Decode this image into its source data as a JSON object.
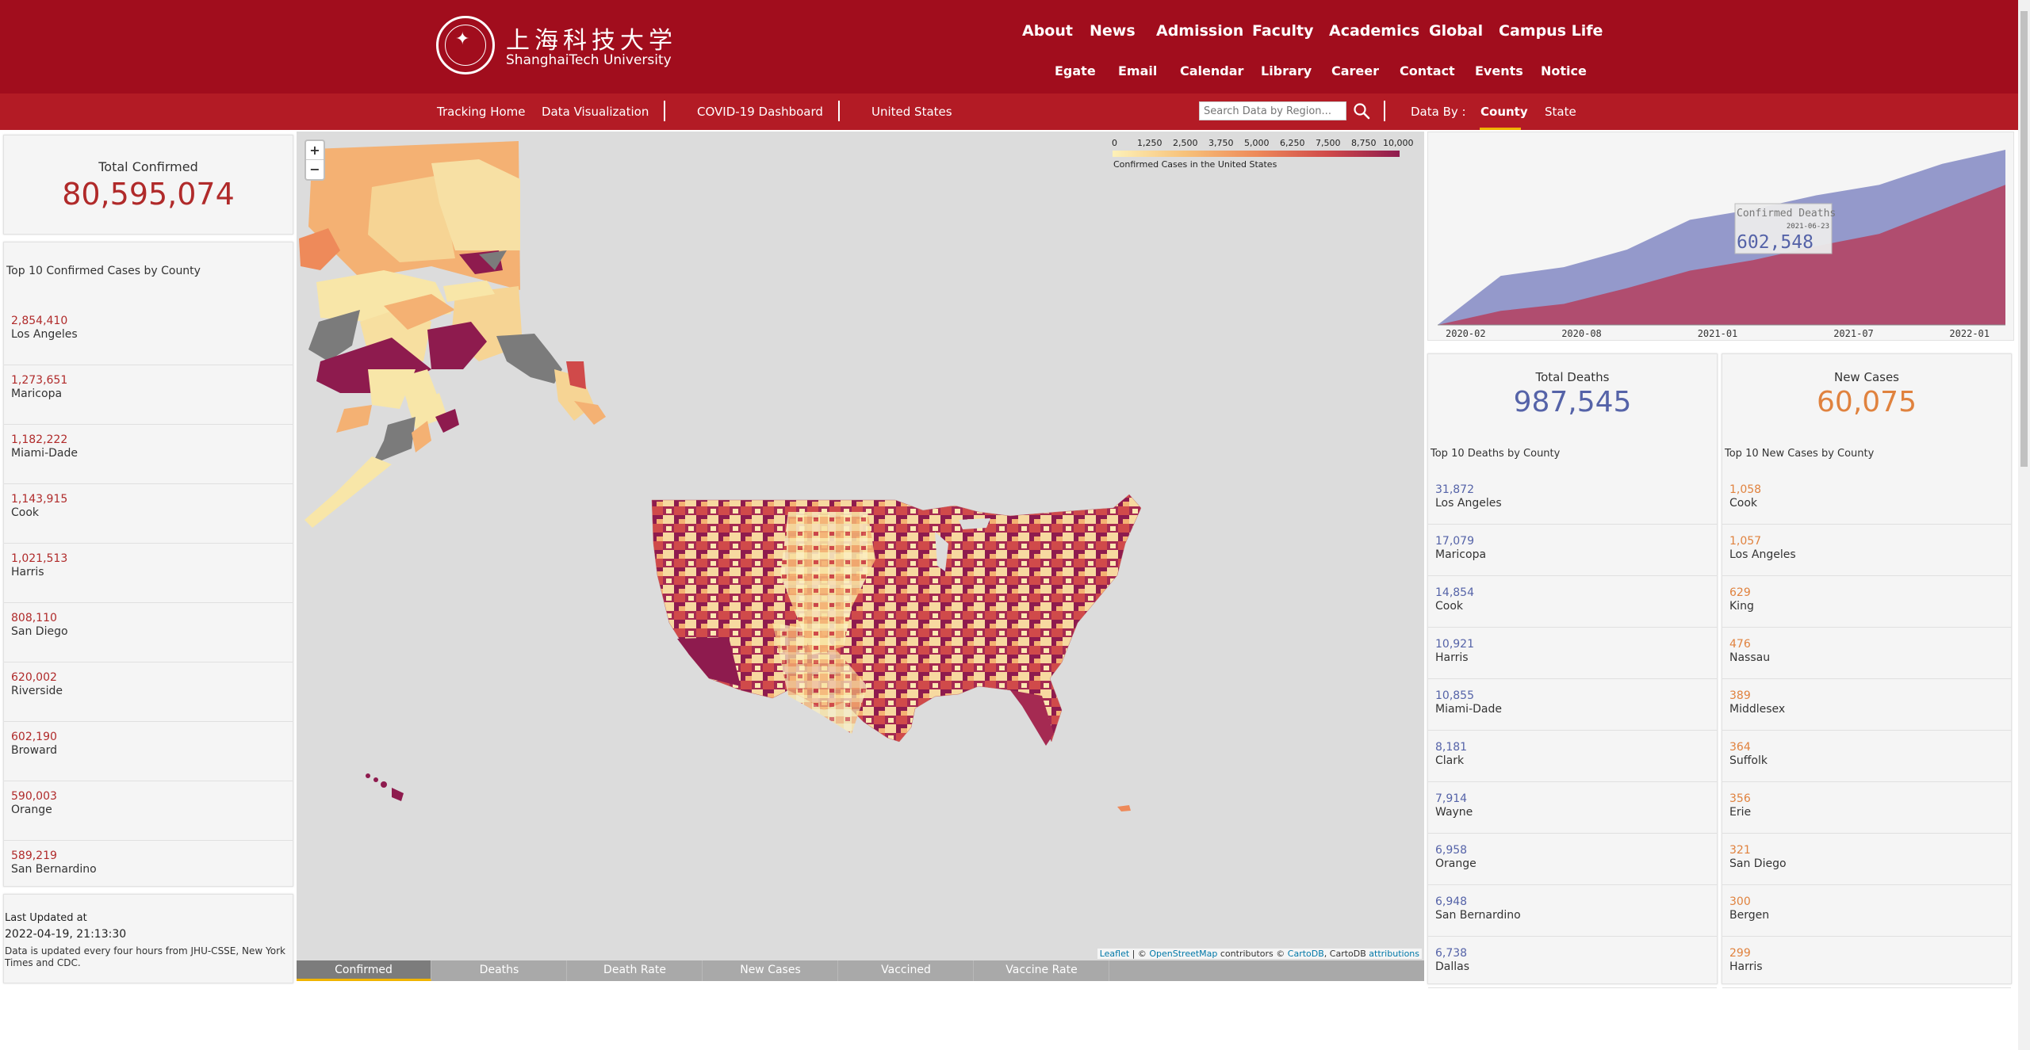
{
  "header": {
    "logo_cn": "上海科技大学",
    "logo_en": "ShanghaiTech University",
    "primary_nav": [
      "About",
      "News",
      "Admission",
      "Faculty",
      "Academics",
      "Global",
      "Campus Life"
    ],
    "secondary_nav": [
      "Egate",
      "Email",
      "Calendar",
      "Library",
      "Career",
      "Contact",
      "Events",
      "Notice"
    ]
  },
  "subnav": {
    "links": [
      "Tracking Home",
      "Data Visualization",
      "COVID-19 Dashboard",
      "United States"
    ],
    "search_placeholder": "Search Data by Region...",
    "data_by_label": "Data By :",
    "data_by_options": [
      "County",
      "State"
    ],
    "data_by_selected": "County"
  },
  "total_confirmed": {
    "label": "Total Confirmed",
    "value": "80,595,074"
  },
  "top_confirmed": {
    "title": "Top 10 Confirmed Cases by County",
    "color": "#b02a2a",
    "items": [
      {
        "value": "2,854,410",
        "name": "Los Angeles"
      },
      {
        "value": "1,273,651",
        "name": "Maricopa"
      },
      {
        "value": "1,182,222",
        "name": "Miami-Dade"
      },
      {
        "value": "1,143,915",
        "name": "Cook"
      },
      {
        "value": "1,021,513",
        "name": "Harris"
      },
      {
        "value": "808,110",
        "name": "San Diego"
      },
      {
        "value": "620,002",
        "name": "Riverside"
      },
      {
        "value": "602,190",
        "name": "Broward"
      },
      {
        "value": "590,003",
        "name": "Orange"
      },
      {
        "value": "589,219",
        "name": "San Bernardino"
      }
    ]
  },
  "last_updated": {
    "title": "Last Updated at",
    "time": "2022-04-19, 21:13:30",
    "note": "Data is updated every four hours from JHU-CSSE, New York Times and CDC."
  },
  "map": {
    "zoom_in": "+",
    "zoom_out": "−",
    "legend_ticks": [
      "0",
      "1,250",
      "2,500",
      "3,750",
      "5,000",
      "6,250",
      "7,500",
      "8,750",
      "10,000"
    ],
    "legend_caption": "Confirmed Cases in the United States",
    "attribution": {
      "leaflet": "Leaflet",
      "osm_prefix": " | © ",
      "osm": "OpenStreetMap",
      "mid": " contributors © ",
      "carto": "CartoDB",
      "mid2": ", CartoDB ",
      "attr": "attributions"
    }
  },
  "tabs": {
    "items": [
      "Confirmed",
      "Deaths",
      "Death Rate",
      "New Cases",
      "Vaccined",
      "Vaccine Rate"
    ],
    "active": "Confirmed"
  },
  "trend_chart": {
    "tooltip_series": "Confirmed Deaths",
    "tooltip_date": "2021-06-23",
    "tooltip_value": "602,548",
    "x_labels": [
      "2020-02",
      "2020-08",
      "2021-01",
      "2021-07",
      "2022-01"
    ],
    "colors": {
      "blue": "#8a8fc6",
      "red": "#b5405f"
    }
  },
  "chart_data": {
    "type": "area",
    "x": [
      "2020-02",
      "2020-05",
      "2020-08",
      "2020-11",
      "2021-01",
      "2021-04",
      "2021-07",
      "2021-10",
      "2022-01",
      "2022-04"
    ],
    "series": [
      {
        "name": "Confirmed",
        "values": [
          0,
          28,
          33,
          43,
          60,
          66,
          74,
          80,
          92,
          100
        ]
      },
      {
        "name": "Deaths",
        "values": [
          0,
          8,
          12,
          21,
          31,
          37,
          45,
          52,
          66,
          80
        ]
      }
    ],
    "xlabel": "",
    "ylabel": ""
  },
  "total_deaths": {
    "label": "Total Deaths",
    "value": "987,545",
    "color": "#5563a8",
    "list_title": "Top 10 Deaths by County",
    "items": [
      {
        "value": "31,872",
        "name": "Los Angeles"
      },
      {
        "value": "17,079",
        "name": "Maricopa"
      },
      {
        "value": "14,854",
        "name": "Cook"
      },
      {
        "value": "10,921",
        "name": "Harris"
      },
      {
        "value": "10,855",
        "name": "Miami-Dade"
      },
      {
        "value": "8,181",
        "name": "Clark"
      },
      {
        "value": "7,914",
        "name": "Wayne"
      },
      {
        "value": "6,958",
        "name": "Orange"
      },
      {
        "value": "6,948",
        "name": "San Bernardino"
      },
      {
        "value": "6,738",
        "name": "Dallas"
      }
    ]
  },
  "new_cases": {
    "label": "New Cases",
    "value": "60,075",
    "color": "#e0823e",
    "list_title": "Top 10 New Cases by County",
    "items": [
      {
        "value": "1,058",
        "name": "Cook"
      },
      {
        "value": "1,057",
        "name": "Los Angeles"
      },
      {
        "value": "629",
        "name": "King"
      },
      {
        "value": "476",
        "name": "Nassau"
      },
      {
        "value": "389",
        "name": "Middlesex"
      },
      {
        "value": "364",
        "name": "Suffolk"
      },
      {
        "value": "356",
        "name": "Erie"
      },
      {
        "value": "321",
        "name": "San Diego"
      },
      {
        "value": "300",
        "name": "Bergen"
      },
      {
        "value": "299",
        "name": "Harris"
      }
    ]
  }
}
